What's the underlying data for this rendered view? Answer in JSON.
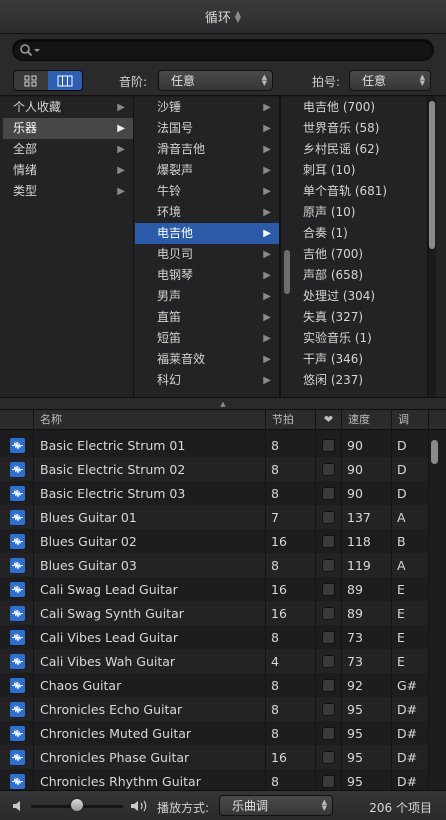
{
  "window": {
    "title": "循环"
  },
  "search": {
    "placeholder": ""
  },
  "filters": {
    "scale_label": "音阶:",
    "scale_value": "任意",
    "signature_label": "拍号:",
    "signature_value": "任意"
  },
  "browser": {
    "column1": [
      {
        "label": "个人收藏"
      },
      {
        "label": "乐器"
      },
      {
        "label": "全部"
      },
      {
        "label": "情绪"
      },
      {
        "label": "类型"
      }
    ],
    "column2": [
      {
        "label": "沙锤"
      },
      {
        "label": "法国号"
      },
      {
        "label": "滑音吉他"
      },
      {
        "label": "爆裂声"
      },
      {
        "label": "牛铃"
      },
      {
        "label": "环境"
      },
      {
        "label": "电吉他"
      },
      {
        "label": "电贝司"
      },
      {
        "label": "电钢琴"
      },
      {
        "label": "男声"
      },
      {
        "label": "直笛"
      },
      {
        "label": "短笛"
      },
      {
        "label": "福莱音效"
      },
      {
        "label": "科幻"
      }
    ],
    "column3": [
      {
        "label": "电吉他 (700)"
      },
      {
        "label": "世界音乐 (58)"
      },
      {
        "label": "乡村民谣 (62)"
      },
      {
        "label": "刺耳 (10)"
      },
      {
        "label": "单个音轨 (681)"
      },
      {
        "label": "原声 (10)"
      },
      {
        "label": "合奏 (1)"
      },
      {
        "label": "吉他 (700)"
      },
      {
        "label": "声部 (658)"
      },
      {
        "label": "处理过 (304)"
      },
      {
        "label": "失真 (327)"
      },
      {
        "label": "实验音乐 (1)"
      },
      {
        "label": "干声 (346)"
      },
      {
        "label": "悠闲 (237)"
      }
    ]
  },
  "table": {
    "headers": {
      "name": "名称",
      "beats": "节拍",
      "fav": "❤",
      "tempo": "速度",
      "key": "调"
    },
    "rows": [
      {
        "name": "Basic Electric Strum 01",
        "beats": "8",
        "tempo": "90",
        "key": "D"
      },
      {
        "name": "Basic Electric Strum 02",
        "beats": "8",
        "tempo": "90",
        "key": "D"
      },
      {
        "name": "Basic Electric Strum 03",
        "beats": "8",
        "tempo": "90",
        "key": "D"
      },
      {
        "name": "Blues Guitar 01",
        "beats": "7",
        "tempo": "137",
        "key": "A"
      },
      {
        "name": "Blues Guitar 02",
        "beats": "16",
        "tempo": "118",
        "key": "B"
      },
      {
        "name": "Blues Guitar 03",
        "beats": "8",
        "tempo": "119",
        "key": "A"
      },
      {
        "name": "Cali Swag Lead Guitar",
        "beats": "16",
        "tempo": "89",
        "key": "E"
      },
      {
        "name": "Cali Swag Synth Guitar",
        "beats": "16",
        "tempo": "89",
        "key": "E"
      },
      {
        "name": "Cali Vibes Lead Guitar",
        "beats": "8",
        "tempo": "73",
        "key": "E"
      },
      {
        "name": "Cali Vibes Wah Guitar",
        "beats": "4",
        "tempo": "73",
        "key": "E"
      },
      {
        "name": "Chaos Guitar",
        "beats": "8",
        "tempo": "92",
        "key": "G#"
      },
      {
        "name": "Chronicles Echo Guitar",
        "beats": "8",
        "tempo": "95",
        "key": "D#"
      },
      {
        "name": "Chronicles Muted Guitar",
        "beats": "8",
        "tempo": "95",
        "key": "D#"
      },
      {
        "name": "Chronicles Phase Guitar",
        "beats": "16",
        "tempo": "95",
        "key": "D#"
      },
      {
        "name": "Chronicles Rhythm Guitar",
        "beats": "8",
        "tempo": "95",
        "key": "D#"
      }
    ]
  },
  "footer": {
    "play_mode_label": "播放方式:",
    "play_mode_value": "乐曲调",
    "item_count": "206 个项目"
  }
}
